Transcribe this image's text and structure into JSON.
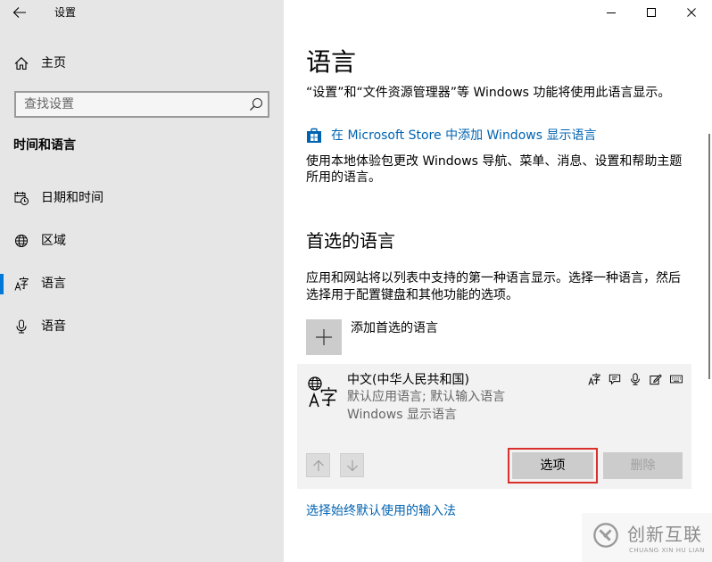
{
  "window": {
    "title": "设置",
    "controls": [
      "minimize-icon",
      "maximize-icon",
      "close-icon"
    ]
  },
  "sidebar": {
    "back_icon": "back-arrow-icon",
    "home_label": "主页",
    "home_icon": "home-icon",
    "search_placeholder": "查找设置",
    "search_icon": "search-icon",
    "section_title": "时间和语言",
    "items": [
      {
        "label": "日期和时间",
        "icon": "calendar-clock-icon",
        "selected": false
      },
      {
        "label": "区域",
        "icon": "region-globe-icon",
        "selected": false
      },
      {
        "label": "语言",
        "icon": "language-icon",
        "selected": true
      },
      {
        "label": "语音",
        "icon": "microphone-icon",
        "selected": false
      }
    ]
  },
  "main": {
    "title": "语言",
    "intro": "“设置”和“文件资源管理器”等 Windows 功能将使用此语言显示。",
    "store_link": {
      "icon": "store-icon",
      "label": "在 Microsoft Store 中添加 Windows 显示语言"
    },
    "store_description": "使用本地体验包更改 Windows 导航、菜单、消息、设置和帮助主题所用的语言。",
    "preferred": {
      "heading": "首选的语言",
      "description": "应用和网站将以列表中支持的第一种语言显示。选择一种语言，然后选择用于配置键盘和其他功能的选项。",
      "add_label": "添加首选的语言",
      "add_icon": "plus-icon",
      "languages": [
        {
          "icon": "language-icon",
          "name": "中文(中华人民共和国)",
          "details": [
            "默认应用语言; 默认输入语言",
            "Windows 显示语言"
          ],
          "features": [
            "language-pack-icon",
            "text-to-speech-icon",
            "speech-recognition-icon",
            "handwriting-icon",
            "keyboard-icon"
          ],
          "move_up_icon": "arrow-up-icon",
          "move_down_icon": "arrow-down-icon",
          "options_label": "选项",
          "remove_label": "删除",
          "remove_disabled": true
        }
      ]
    },
    "input_method_link": "选择始终默认使用的输入法"
  },
  "watermark": {
    "text": "创新互联",
    "subtext": "CHUANG XIN HU LIAN",
    "icon": "watermark-logo-icon"
  },
  "colors": {
    "accent": "#0078d7",
    "link": "#0063b1",
    "sidebar_bg": "#e6e6e6",
    "content_bg": "#ffffff",
    "card_bg": "#f2f2f2",
    "button_bg": "#cccccc",
    "secondary_text": "#666666",
    "disabled_text": "#a0a0a0",
    "highlight": "#d9302c"
  }
}
